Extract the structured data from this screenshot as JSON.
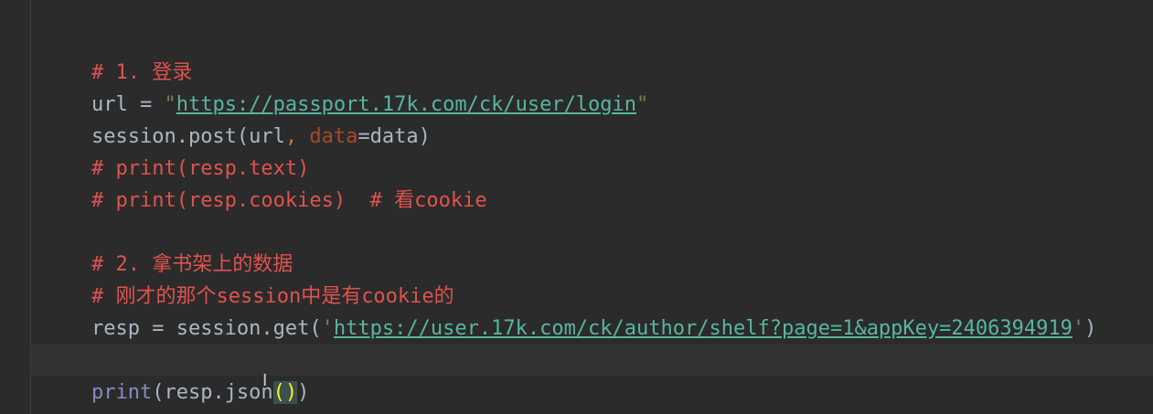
{
  "code": {
    "line1_comment": "# 1. 登录",
    "line2_var": "url = ",
    "line2_quote_open": "\"",
    "line2_url": "https://passport.17k.com/ck/user/login",
    "line2_quote_close": "\"",
    "line3_a": "session.post(url",
    "line3_comma": ",",
    "line3_space": " ",
    "line3_param": "data",
    "line3_b": "=data)",
    "line4_comment": "# print(resp.text)",
    "line5_comment": "# print(resp.cookies)  # 看cookie",
    "line7_comment": "# 2. 拿书架上的数据",
    "line8_comment": "# 刚才的那个session中是有cookie的",
    "line9_a": "resp = session.get(",
    "line9_quote_open": "'",
    "line9_url": "https://user.17k.com/ck/author/shelf?page=1&appKey=2406394919",
    "line9_quote_close": "'",
    "line9_b": ")",
    "line11_builtin": "print",
    "line11_a": "(resp.json",
    "line11_match": "()",
    "line11_b": ")",
    "cursor_glyph": "I"
  },
  "colors": {
    "background": "#2b2b2b",
    "comment": "#e0524f",
    "url": "#56b6a0",
    "string": "#6a8759",
    "builtin": "#8888c6"
  }
}
